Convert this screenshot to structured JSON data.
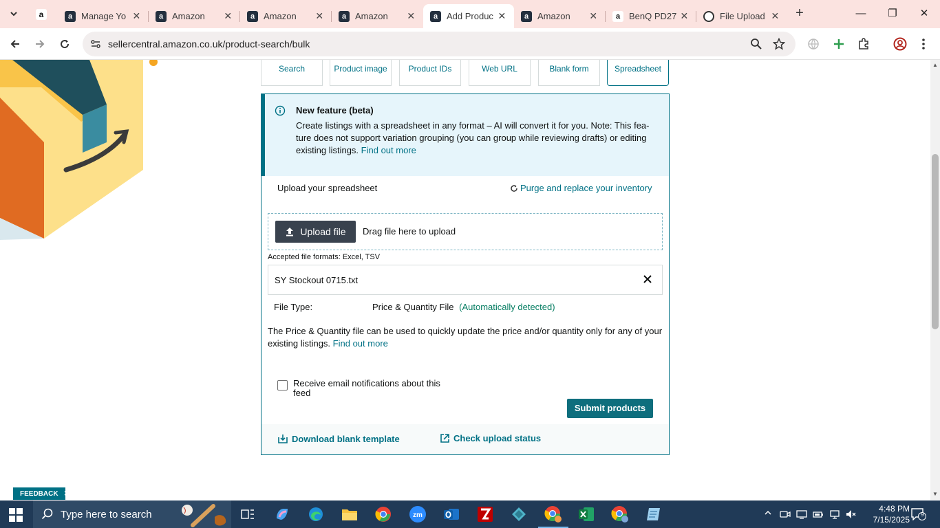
{
  "browser": {
    "tabs": [
      {
        "title": "Manage Yo",
        "icon": "amazon-favicon"
      },
      {
        "title": "Amazon",
        "icon": "amazon-favicon"
      },
      {
        "title": "Amazon",
        "icon": "amazon-favicon"
      },
      {
        "title": "Amazon",
        "icon": "amazon-favicon"
      },
      {
        "title": "Add Produc",
        "icon": "amazon-favicon",
        "active": true
      },
      {
        "title": "Amazon",
        "icon": "amazon-favicon"
      },
      {
        "title": "BenQ PD27",
        "icon": "amazon-smile-favicon"
      },
      {
        "title": "File Upload",
        "icon": "openai-favicon"
      }
    ],
    "url": "sellercentral.amazon.co.uk/product-search/bulk"
  },
  "product_tabs": [
    "Search",
    "Product image",
    "Product IDs",
    "Web URL",
    "Blank form",
    "Spreadsheet"
  ],
  "beta_banner": {
    "title": "New feature (beta)",
    "body": "Create listings with a spreadsheet in any format – AI will convert it for you. Note: This fea-ture does not support variation grouping (you can group while reviewing drafts) or editing existing listings.",
    "link": "Find out more"
  },
  "upload": {
    "label": "Upload your spreadsheet",
    "purge_link": "Purge and replace your inventory",
    "button": "Upload file",
    "drag_text": "Drag file here to upload",
    "formats": "Accepted file formats: Excel, TSV",
    "file_name": "SY Stockout 0715.txt",
    "file_type_label": "File Type:",
    "file_type_value": "Price & Quantity File",
    "file_type_note": "(Automatically detected)",
    "description": "The Price & Quantity file can be used to quickly update the price and/or quantity only for any of your existing listings.",
    "description_link": "Find out more",
    "notify_label": "Receive email notifications about this feed",
    "submit": "Submit products"
  },
  "footer": {
    "download_template": "Download blank template",
    "check_status": "Check upload status"
  },
  "feedback": "FEEDBACK",
  "taskbar": {
    "search_placeholder": "Type here to search",
    "time": "4:48 PM",
    "date": "7/15/2025",
    "notification_count": "9"
  },
  "colors": {
    "accent": "#007185",
    "banner_bg": "#e6f5fb",
    "submit_bg": "#0e6e7d",
    "tabstrip_bg": "#fbe3e0",
    "taskbar_bg": "#203a57"
  }
}
